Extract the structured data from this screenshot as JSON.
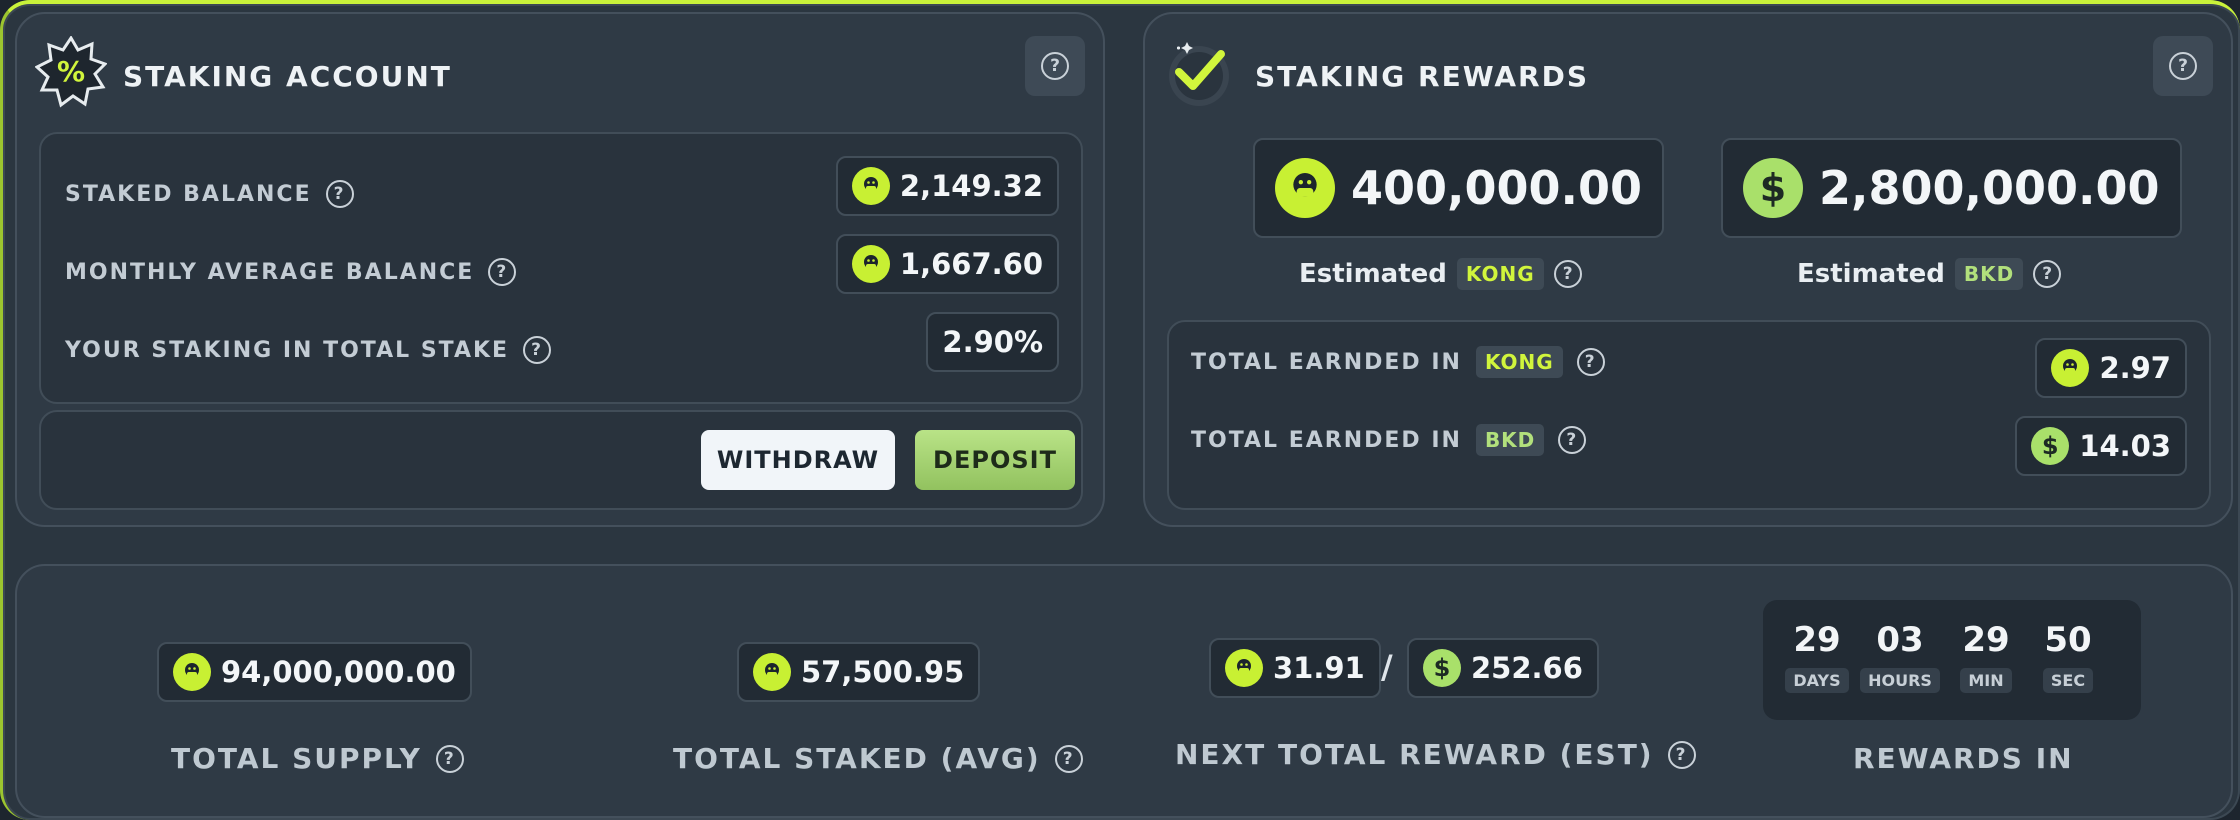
{
  "staking_account": {
    "title": "STAKING ACCOUNT",
    "rows": [
      {
        "label": "STAKED BALANCE",
        "value": "2,149.32"
      },
      {
        "label": "MONTHLY AVERAGE BALANCE",
        "value": "1,667.60"
      },
      {
        "label": "YOUR STAKING IN TOTAL STAKE",
        "value": "2.90%"
      }
    ],
    "withdraw_label": "WITHDRAW",
    "deposit_label": "DEPOSIT"
  },
  "staking_rewards": {
    "title": "STAKING REWARDS",
    "kong_estimate": "400,000.00",
    "bkd_estimate": "2,800,000.00",
    "estimated_label": "Estimated",
    "kong_token": "KONG",
    "bkd_token": "BKD",
    "earned_label": "TOTAL EARNDED IN",
    "earned_kong": "2.97",
    "earned_bkd": "14.03"
  },
  "stats": {
    "total_supply": {
      "value": "94,000,000.00",
      "label": "TOTAL SUPPLY"
    },
    "total_staked": {
      "value": "57,500.95",
      "label": "TOTAL STAKED (AVG)"
    },
    "next_reward": {
      "kong": "31.91",
      "separator": "/",
      "bkd": "252.66",
      "label": "NEXT TOTAL REWARD (EST)"
    },
    "rewards_in": {
      "label": "REWARDS IN",
      "days": "29",
      "hours": "03",
      "min": "29",
      "sec": "50",
      "days_label": "DAYS",
      "hours_label": "HOURS",
      "min_label": "MIN",
      "sec_label": "SEC"
    }
  },
  "icons": {
    "help": "?",
    "kong_coin": "kong-coin-icon",
    "dollar_coin": "$",
    "staking_account_logo": "percent-badge-icon",
    "staking_rewards_logo": "checkmark-badge-icon"
  },
  "colors": {
    "accent": "#c9f23a",
    "kong_coin": "#c8f033",
    "bkd_coin": "#a9e06a",
    "panel": "#2f3a45",
    "background": "#2b3640"
  }
}
